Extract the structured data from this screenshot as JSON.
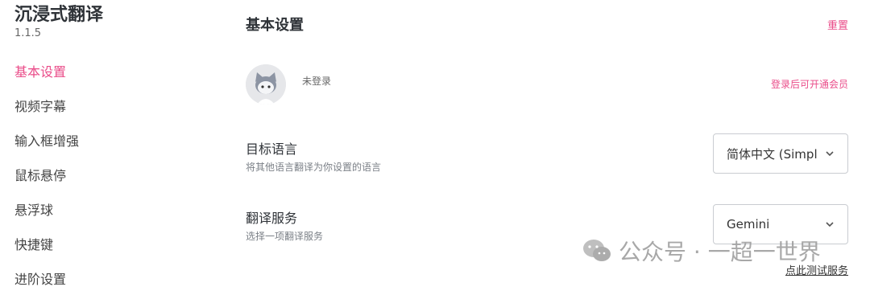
{
  "sidebar": {
    "app_title": "沉浸式翻译",
    "version": "1.1.5",
    "items": [
      {
        "label": "基本设置"
      },
      {
        "label": "视频字幕"
      },
      {
        "label": "输入框增强"
      },
      {
        "label": "鼠标悬停"
      },
      {
        "label": "悬浮球"
      },
      {
        "label": "快捷键"
      },
      {
        "label": "进阶设置"
      }
    ]
  },
  "header": {
    "title": "基本设置",
    "reset_label": "重置"
  },
  "account": {
    "status": "未登录",
    "member_link": "登录后可开通会员"
  },
  "target_language": {
    "label": "目标语言",
    "description": "将其他语言翻译为你设置的语言",
    "selected": "简体中文 (Simplified Chinese)"
  },
  "translate_service": {
    "label": "翻译服务",
    "description": "选择一项翻译服务",
    "selected": "Gemini",
    "test_link": "点此测试服务"
  },
  "watermark": {
    "text": "公众号 · 一超一世界"
  },
  "colors": {
    "accent": "#ea4c89",
    "text_dark": "#2f3338",
    "muted": "#7b8087"
  }
}
